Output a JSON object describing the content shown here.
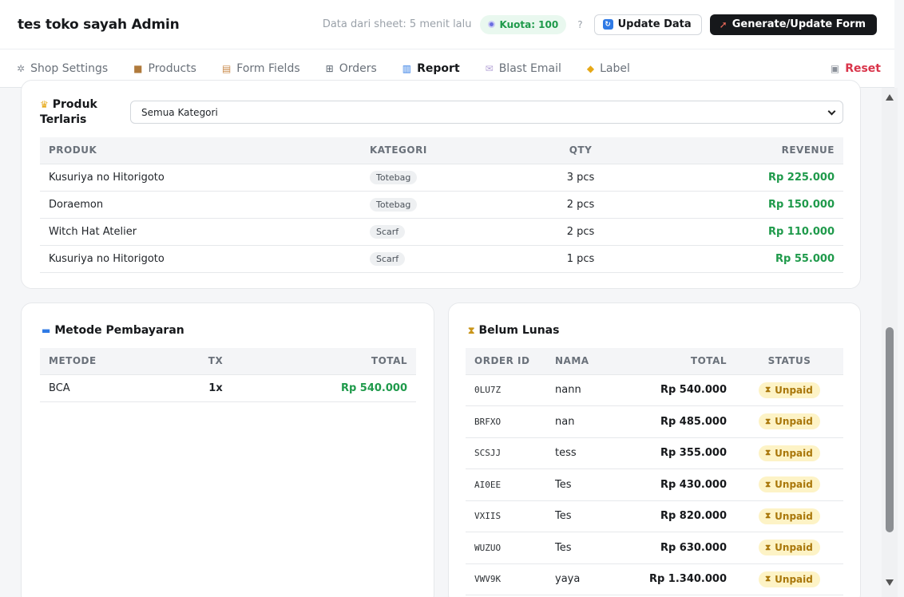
{
  "header": {
    "title": "tes toko sayah Admin",
    "sync_status": "Data dari sheet: 5 menit lalu",
    "quota_label": "Kuota: 100",
    "help": "?",
    "update_button": "Update Data",
    "generate_button": "Generate/Update Form"
  },
  "tabs": [
    {
      "label": "Shop Settings",
      "icon": "gear-icon"
    },
    {
      "label": "Products",
      "icon": "box-icon"
    },
    {
      "label": "Form Fields",
      "icon": "clipboard-icon"
    },
    {
      "label": "Orders",
      "icon": "cart-icon"
    },
    {
      "label": "Report",
      "icon": "chart-icon",
      "active": true
    },
    {
      "label": "Blast Email",
      "icon": "mail-icon"
    },
    {
      "label": "Label",
      "icon": "tag-icon"
    },
    {
      "label": "Reset",
      "icon": "trash-icon"
    }
  ],
  "best_sellers": {
    "title_line1": "Produk",
    "title_line2": "Terlaris",
    "category_select": "Semua Kategori",
    "columns": [
      "PRODUK",
      "KATEGORI",
      "QTY",
      "REVENUE"
    ],
    "rows": [
      {
        "product": "Kusuriya no Hitorigoto",
        "category": "Totebag",
        "qty": "3 pcs",
        "revenue": "Rp 225.000"
      },
      {
        "product": "Doraemon",
        "category": "Totebag",
        "qty": "2 pcs",
        "revenue": "Rp 150.000"
      },
      {
        "product": "Witch Hat Atelier",
        "category": "Scarf",
        "qty": "2 pcs",
        "revenue": "Rp 110.000"
      },
      {
        "product": "Kusuriya no Hitorigoto",
        "category": "Scarf",
        "qty": "1 pcs",
        "revenue": "Rp 55.000"
      }
    ]
  },
  "payment_methods": {
    "title": "Metode Pembayaran",
    "columns": [
      "METODE",
      "TX",
      "TOTAL"
    ],
    "rows": [
      {
        "method": "BCA",
        "tx": "1x",
        "total": "Rp 540.000"
      }
    ]
  },
  "unpaid": {
    "title": "Belum Lunas",
    "columns": [
      "ORDER ID",
      "NAMA",
      "TOTAL",
      "STATUS"
    ],
    "rows": [
      {
        "id": "0LU7Z",
        "name": "nann",
        "total": "Rp 540.000",
        "status": "Unpaid"
      },
      {
        "id": "BRFXO",
        "name": "nan",
        "total": "Rp 485.000",
        "status": "Unpaid"
      },
      {
        "id": "SCSJJ",
        "name": "tess",
        "total": "Rp 355.000",
        "status": "Unpaid"
      },
      {
        "id": "AI0EE",
        "name": "Tes",
        "total": "Rp 430.000",
        "status": "Unpaid"
      },
      {
        "id": "VXIIS",
        "name": "Tes",
        "total": "Rp 820.000",
        "status": "Unpaid"
      },
      {
        "id": "WUZUO",
        "name": "Tes",
        "total": "Rp 630.000",
        "status": "Unpaid"
      },
      {
        "id": "VWV9K",
        "name": "yaya",
        "total": "Rp 1.340.000",
        "status": "Unpaid"
      }
    ]
  },
  "colors": {
    "accent_green": "#1f9a4b",
    "danger_red": "#d9344a",
    "unpaid_bg": "#fdf3c6",
    "dark_button": "#16181b"
  }
}
